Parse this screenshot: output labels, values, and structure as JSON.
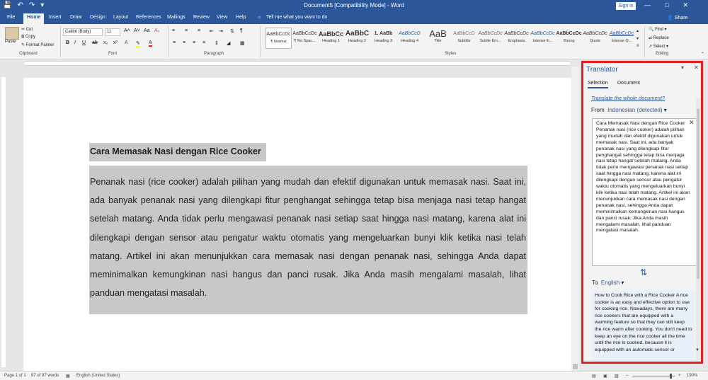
{
  "titlebar": {
    "document_title": "Document5 [Compatibility Mode] - Word",
    "signin_label": "Sign in",
    "qat": [
      "save-icon",
      "undo-icon",
      "redo-icon",
      "customize-icon"
    ]
  },
  "tabs": [
    "File",
    "Home",
    "Insert",
    "Draw",
    "Design",
    "Layout",
    "References",
    "Mailings",
    "Review",
    "View",
    "Help"
  ],
  "tell_me": "Tell me what you want to do",
  "share_label": "Share",
  "ribbon": {
    "clipboard": {
      "paste": "Paste",
      "cut": "Cut",
      "copy": "Copy",
      "format_painter": "Format Painter",
      "label": "Clipboard"
    },
    "font": {
      "name": "Calibri (Body)",
      "size": "11",
      "label": "Font"
    },
    "paragraph": {
      "label": "Paragraph"
    },
    "styles": {
      "label": "Styles",
      "items": [
        {
          "preview": "AaBbCcDc",
          "name": "¶ Normal"
        },
        {
          "preview": "AaBbCcDc",
          "name": "¶ No Spac..."
        },
        {
          "preview": "AaBbCc",
          "name": "Heading 1"
        },
        {
          "preview": "AaBbC",
          "name": "Heading 2"
        },
        {
          "preview": "1. AaBb",
          "name": "Heading 3"
        },
        {
          "preview": "AaBbCcD",
          "name": "Heading 4"
        },
        {
          "preview": "AaB",
          "name": "Title"
        },
        {
          "preview": "AaBbCcD",
          "name": "Subtitle"
        },
        {
          "preview": "AaBbCcDc",
          "name": "Subtle Em..."
        },
        {
          "preview": "AaBbCcDc",
          "name": "Emphasis"
        },
        {
          "preview": "AaBbCcDc",
          "name": "Intense E..."
        },
        {
          "preview": "AaBbCcDc",
          "name": "Strong"
        },
        {
          "preview": "AaBbCcDc",
          "name": "Quote"
        },
        {
          "preview": "AaBbCcDc",
          "name": "Intense Q..."
        }
      ]
    },
    "editing": {
      "find": "Find",
      "replace": "Replace",
      "select": "Select",
      "label": "Editing"
    }
  },
  "document": {
    "title": "Cara Memasak Nasi dengan Rice Cooker",
    "paragraph": "Penanak nasi (rice cooker) adalah pilihan yang mudah dan efektif digunakan untuk memasak nasi. Saat ini, ada banyak penanak nasi yang dilengkapi fitur penghangat sehingga tetap bisa menjaga nasi tetap hangat setelah matang. Anda tidak perlu mengawasi penanak nasi setiap saat hingga nasi matang, karena alat ini dilengkapi dengan sensor atau pengatur waktu otomatis yang mengeluarkan bunyi klik ketika nasi telah matang. Artikel ini akan menunjukkan cara memasak nasi dengan penanak nasi, sehingga Anda dapat meminimalkan kemungkinan nasi hangus dan panci rusak. Jika Anda masih mengalami masalah, lihat panduan mengatasi masalah."
  },
  "translator": {
    "title": "Translator",
    "tab_selection": "Selection",
    "tab_document": "Document",
    "link": "Translate the whole document?",
    "from_label": "From",
    "from_lang": "Indonesian (detected)",
    "source_text": "Cara Memasak Nasi dengan Rice Cooker Penanak nasi (rice cooker) adalah pilihan yang mudah dan efektif digunakan untuk memasak nasi. Saat ini, ada banyak penanak nasi yang dilengkapi fitur penghangat sehingga tetap bisa menjaga nasi tetap hangat setelah matang. Anda tidak perlu mengawasi penanak nasi setiap saat hingga nasi matang, karena alat ini dilengkapi dengan sensor atau pengatur waktu otomatis yang mengeluarkan bunyi klik ketika nasi telah matang. Artikel ini akan menunjukkan cara memasak nasi dengan penanak nasi, sehingga Anda dapat meminimalkan kemungkinan nasi hangus dan panci rusak. Jika Anda masih mengalami masalah, lihat panduan mengatasi masalah.",
    "to_label": "To",
    "to_lang": "English",
    "target_text": "How to Cook Rice with a Rice Cooker A rice cooker is an easy and effective option to use for cooking rice. Nowadays, there are many rice cookers that are equipped with a warming feature so that they can still keep the rice warm after cooking. You don't need to keep an eye on the rice cooker all the time until the rice is cooked, because it is equipped with an automatic sensor or"
  },
  "status": {
    "page": "Page 1 of 1",
    "words": "97 of 97 words",
    "language": "English (United States)",
    "zoom": "190%"
  }
}
